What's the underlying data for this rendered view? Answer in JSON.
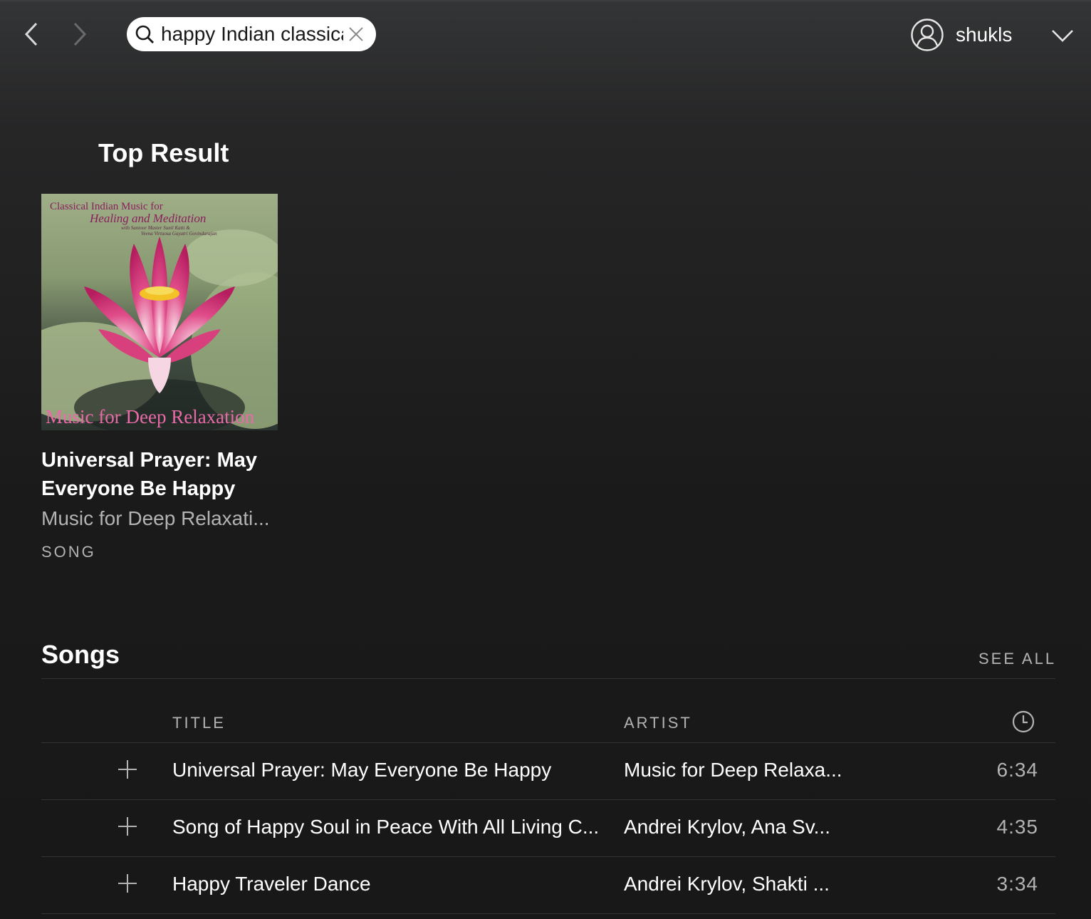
{
  "search": {
    "value": "happy Indian classica"
  },
  "user": {
    "name": "shukls"
  },
  "top_result": {
    "heading": "Top Result",
    "cover": {
      "line1": "Classical Indian Music for",
      "line2": "Healing and Meditation",
      "line3": "with Santoor Master Sunil Katti &",
      "line4": "Veena Virtuosa Gayatri Govindarajan",
      "bottom": "Music for Deep Relaxation"
    },
    "title": "Universal Prayer: May Everyone Be Happy",
    "subtitle": "Music for Deep Relaxati...",
    "type": "SONG"
  },
  "songs": {
    "heading": "Songs",
    "see_all": "SEE ALL",
    "columns": {
      "title": "TITLE",
      "artist": "ARTIST"
    },
    "rows": [
      {
        "title": "Universal Prayer: May Everyone Be Happy",
        "artist": "Music for Deep Relaxa...",
        "duration": "6:34"
      },
      {
        "title": "Song of Happy Soul in Peace With All Living C...",
        "artist": "Andrei Krylov, Ana Sv...",
        "duration": "4:35"
      },
      {
        "title": "Happy Traveler Dance",
        "artist": "Andrei Krylov, Shakti ...",
        "duration": "3:34"
      }
    ]
  },
  "colors": {
    "background": "#181818",
    "text": "#ffffff",
    "muted": "#b3b3b3",
    "cover_text": "#8a1f5e"
  }
}
